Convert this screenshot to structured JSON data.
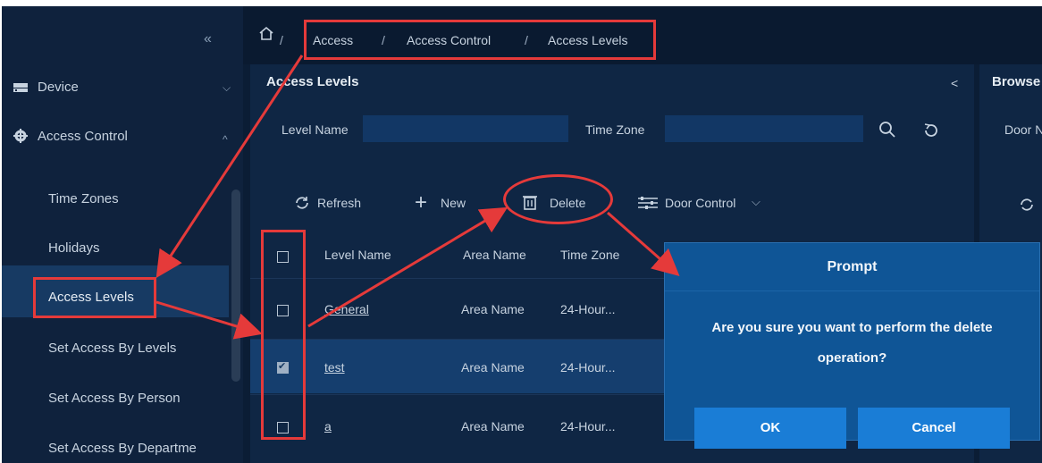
{
  "colors": {
    "accent": "#1a7dd6",
    "annotation": "#e53a3a",
    "background": "#0b1d35"
  },
  "sidebar": {
    "collapse_icon": "«",
    "device": {
      "label": "Device",
      "icon": "device-icon"
    },
    "access_control": {
      "label": "Access Control",
      "icon": "gear-icon"
    },
    "items": [
      {
        "label": "Time Zones"
      },
      {
        "label": "Holidays"
      },
      {
        "label": "Access Levels"
      },
      {
        "label": "Set Access By Levels"
      },
      {
        "label": "Set Access By Person"
      },
      {
        "label": "Set Access By Departme"
      }
    ]
  },
  "breadcrumb": {
    "home_icon": "home-icon",
    "items": [
      "Access",
      "Access Control",
      "Access Levels"
    ]
  },
  "panel": {
    "title": "Access Levels",
    "filters": {
      "level_name_label": "Level Name",
      "time_zone_label": "Time Zone"
    },
    "toolbar": {
      "refresh": "Refresh",
      "new": "New",
      "delete": "Delete",
      "door_control": "Door Control"
    },
    "table": {
      "headers": {
        "level_name": "Level Name",
        "area_name": "Area Name",
        "time_zone": "Time Zone"
      },
      "rows": [
        {
          "level_name": "General",
          "area_name": "Area Name",
          "time_zone": "24-Hour...",
          "checked": false
        },
        {
          "level_name": "test",
          "area_name": "Area Name",
          "time_zone": "24-Hour...",
          "checked": true
        },
        {
          "level_name": "a",
          "area_name": "Area Name",
          "time_zone": "24-Hour...",
          "checked": false
        }
      ]
    }
  },
  "right_panel": {
    "title": "Browse",
    "door_label": "Door N"
  },
  "dialog": {
    "title": "Prompt",
    "message_line1": "Are you sure you want to perform the delete",
    "message_line2": "operation?",
    "ok": "OK",
    "cancel": "Cancel"
  }
}
